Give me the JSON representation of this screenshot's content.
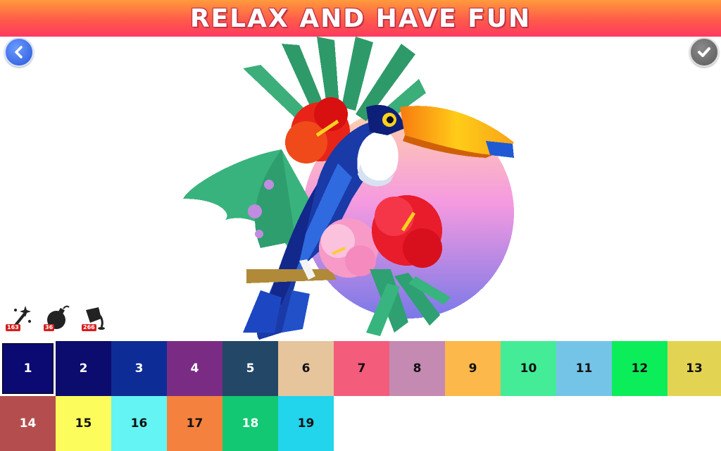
{
  "header": {
    "title": "RELAX AND HAVE FUN"
  },
  "nav": {
    "back_icon": "chevron-left-icon",
    "done_icon": "checkmark-icon"
  },
  "artwork": {
    "subject": "toucan-pixel-art"
  },
  "tools": [
    {
      "name": "magic-wand",
      "icon": "magic-wand-icon",
      "count": "163"
    },
    {
      "name": "bomb",
      "icon": "bomb-icon",
      "count": "36"
    },
    {
      "name": "paint-bucket",
      "icon": "paint-bucket-icon",
      "count": "266"
    }
  ],
  "palette": {
    "selected": "1",
    "colors": [
      {
        "label": "1",
        "color": "#0a0a72"
      },
      {
        "label": "2",
        "color": "#0c0c6e"
      },
      {
        "label": "3",
        "color": "#0e2c96"
      },
      {
        "label": "4",
        "color": "#7a2c84"
      },
      {
        "label": "5",
        "color": "#234766"
      },
      {
        "label": "6",
        "color": "#e6c49c"
      },
      {
        "label": "7",
        "color": "#f45c7c"
      },
      {
        "label": "8",
        "color": "#c48ab2"
      },
      {
        "label": "9",
        "color": "#fcb84a"
      },
      {
        "label": "10",
        "color": "#44ec98"
      },
      {
        "label": "11",
        "color": "#74c4e8"
      },
      {
        "label": "12",
        "color": "#0ced5a"
      },
      {
        "label": "13",
        "color": "#e2d452"
      },
      {
        "label": "14",
        "color": "#b44e4e"
      },
      {
        "label": "15",
        "color": "#fcfc5c"
      },
      {
        "label": "16",
        "color": "#64f4f4"
      },
      {
        "label": "17",
        "color": "#f4823e"
      },
      {
        "label": "18",
        "color": "#12c872"
      },
      {
        "label": "19",
        "color": "#22d4ec"
      }
    ]
  }
}
